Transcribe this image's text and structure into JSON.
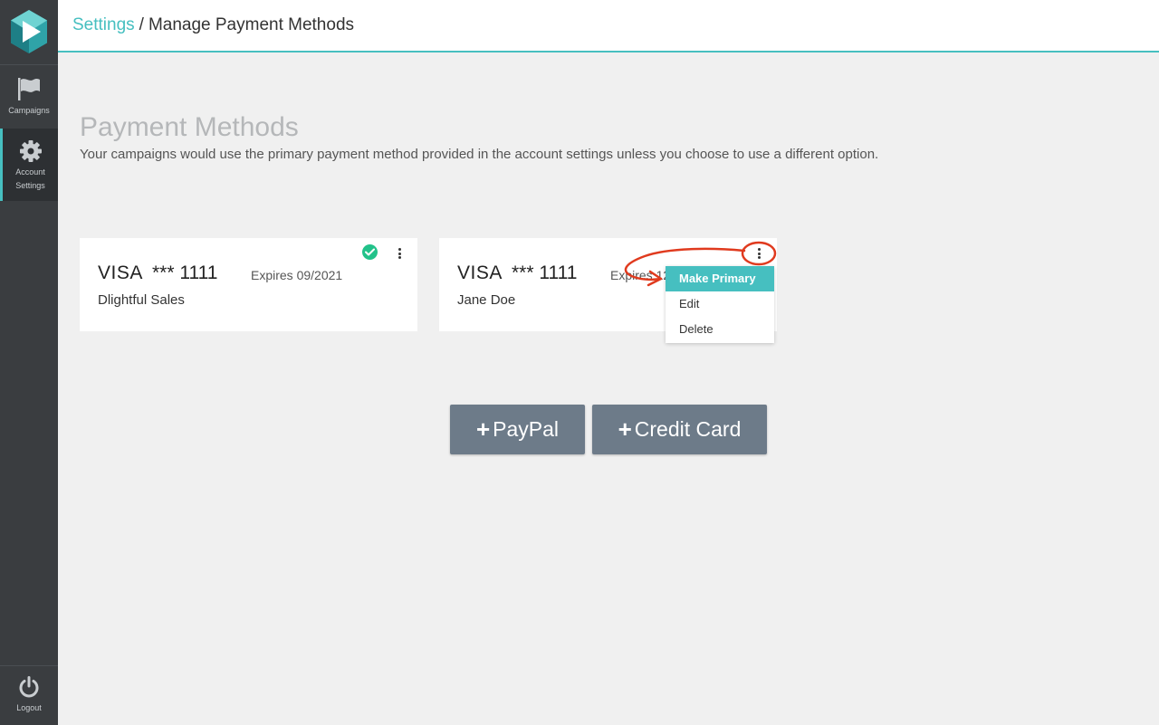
{
  "sidebar": {
    "items": [
      {
        "label": "Campaigns",
        "icon": "flag-icon"
      },
      {
        "label": "Account",
        "label2": "Settings",
        "icon": "gear-icon"
      }
    ],
    "logout": {
      "label": "Logout",
      "icon": "power-icon"
    }
  },
  "header": {
    "crumb_link": "Settings",
    "crumb_sep": "/",
    "crumb_current": "Manage Payment Methods"
  },
  "main": {
    "title": "Payment Methods",
    "description": "Your campaigns would use the primary payment method provided in the account settings unless you choose to use a different option."
  },
  "cards": [
    {
      "brand": "VISA",
      "number": "*** 1111",
      "expires": "Expires 09/2021",
      "holder": "Dlightful Sales",
      "primary": true
    },
    {
      "brand": "VISA",
      "number": "*** 1111",
      "expires": "Expires 12",
      "holder": "Jane Doe",
      "primary": false
    }
  ],
  "menu": {
    "items": [
      "Make Primary",
      "Edit",
      "Delete"
    ]
  },
  "buttons": {
    "plus": "+",
    "paypal": "PayPal",
    "credit_card": "Credit Card"
  },
  "colors": {
    "accent": "#46bfc0",
    "sidebar": "#3a3d40",
    "button": "#6d7b89",
    "check": "#22c28a",
    "annotation": "#e03a1e"
  }
}
